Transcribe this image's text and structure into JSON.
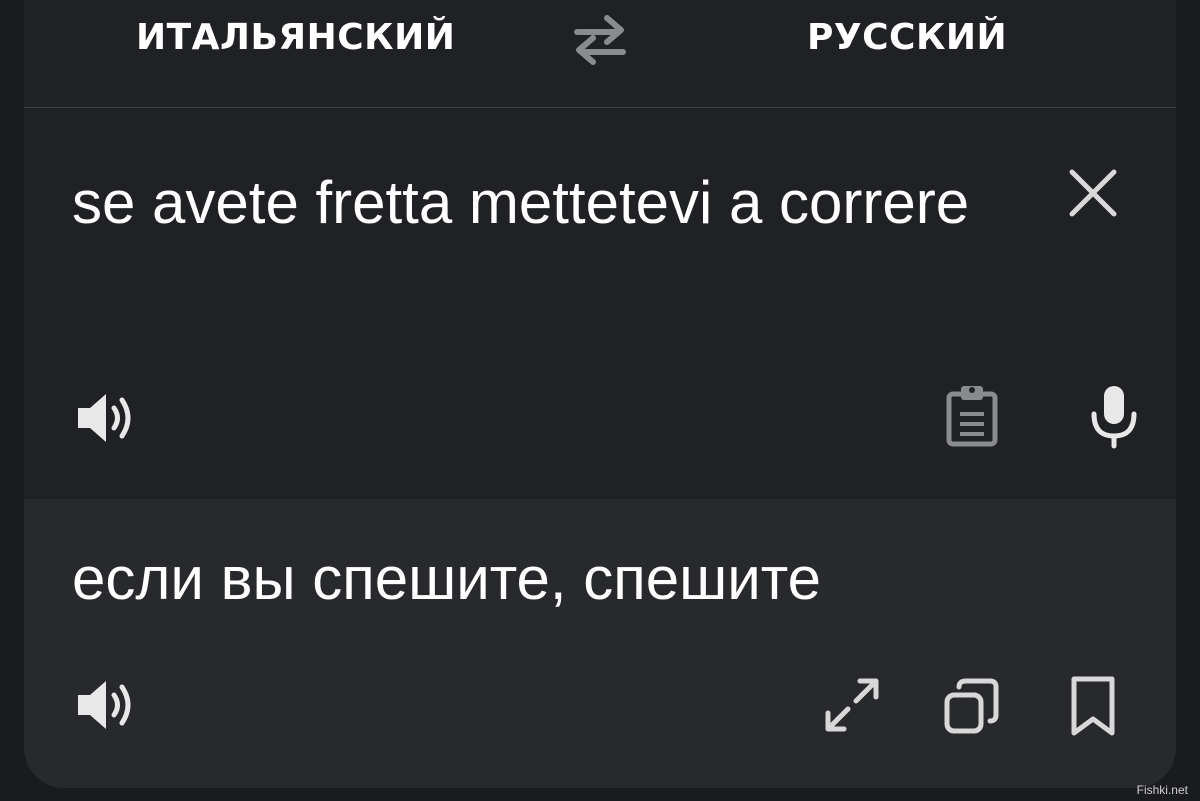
{
  "lang_bar": {
    "source_lang": "ИТАЛЬЯНСКИЙ",
    "target_lang": "РУССКИЙ",
    "swap_icon": "swap-arrows-icon"
  },
  "input": {
    "text": "se avete fretta mettetevi a correre",
    "clear_icon": "close-icon",
    "speak_icon": "speaker-icon",
    "paste_icon": "clipboard-icon",
    "mic_icon": "microphone-icon"
  },
  "output": {
    "text": "если вы спешите, спешите",
    "speak_icon": "speaker-icon",
    "fullscreen_icon": "expand-icon",
    "copy_icon": "copy-icon",
    "save_icon": "bookmark-icon"
  },
  "watermark": "Fishki.net",
  "colors": {
    "background": "#1a1b1e",
    "input_pane": "#202124",
    "output_pane": "#28292c",
    "text": "#ffffff",
    "icon_light": "#e8e8e8",
    "icon_dim": "#8a8b8e"
  }
}
